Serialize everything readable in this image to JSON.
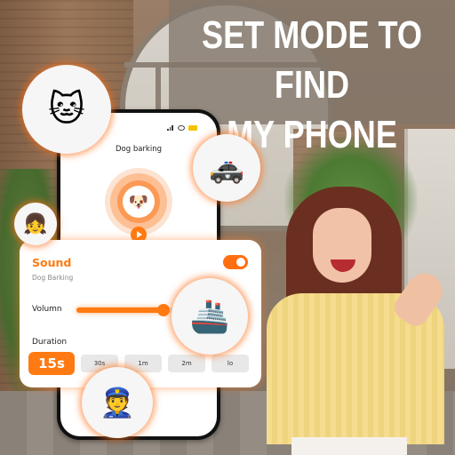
{
  "headline": {
    "line1": "SET MODE TO FIND",
    "line2": "MY PHONE"
  },
  "phone": {
    "status_bar": [
      "signal-icon",
      "wifi-icon",
      "battery-icon"
    ],
    "screen_title": "Dog barking",
    "center_icon": "🐶",
    "play_button_icon": "play-icon"
  },
  "settings": {
    "sound_label": "Sound",
    "sound_sub": "Dog Barking",
    "sound_toggle_on": true,
    "volume_label": "Volumn",
    "volume_level": 0.75,
    "duration_label": "Duration",
    "durations": [
      {
        "label": "15s",
        "active": true
      },
      {
        "label": "30s",
        "active": false
      },
      {
        "label": "1m",
        "active": false
      },
      {
        "label": "2m",
        "active": false
      },
      {
        "label": "lo",
        "active": false
      }
    ]
  },
  "sound_bubbles": [
    {
      "name": "cat",
      "glyph": "🐱"
    },
    {
      "name": "police-car",
      "glyph": "🚓"
    },
    {
      "name": "girl",
      "glyph": "👧"
    },
    {
      "name": "ship",
      "glyph": "🚢"
    },
    {
      "name": "police-man",
      "glyph": "👮"
    }
  ],
  "colors": {
    "accent": "#ff7a12",
    "banner": "#82766a",
    "chip_inactive": "#e8e8e8"
  }
}
